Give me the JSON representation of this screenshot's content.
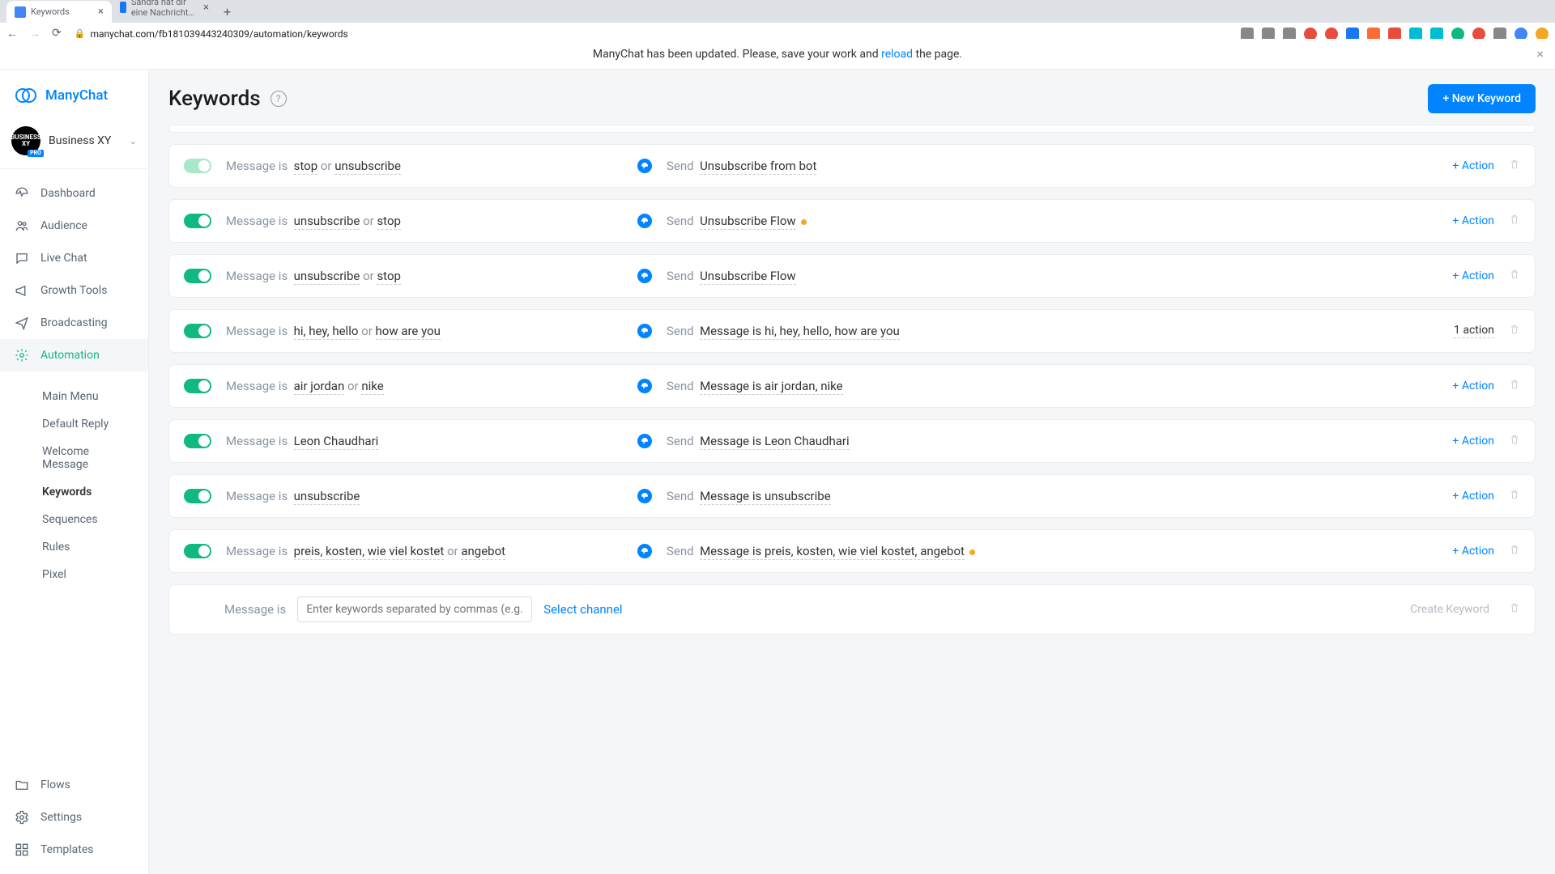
{
  "browser": {
    "tabs": [
      {
        "title": "Keywords",
        "active": true,
        "favicon": "blue"
      },
      {
        "title": "Sandra hat dir eine Nachricht…",
        "active": false,
        "favicon": "fb"
      }
    ],
    "url": "manychat.com/fb181039443240309/automation/keywords"
  },
  "banner": {
    "prefix": "ManyChat has been updated. Please, save your work and ",
    "link": "reload",
    "suffix": " the page."
  },
  "brand": {
    "name": "ManyChat"
  },
  "workspace": {
    "name": "Business XY",
    "badge": "PRO",
    "avatar_text": "BUSINESS XY"
  },
  "nav": {
    "dashboard": "Dashboard",
    "audience": "Audience",
    "livechat": "Live Chat",
    "growth": "Growth Tools",
    "broadcasting": "Broadcasting",
    "automation": "Automation",
    "flows": "Flows",
    "settings": "Settings",
    "templates": "Templates"
  },
  "subnav": {
    "main_menu": "Main Menu",
    "default_reply": "Default Reply",
    "welcome": "Welcome Message",
    "keywords": "Keywords",
    "sequences": "Sequences",
    "rules": "Rules",
    "pixel": "Pixel"
  },
  "page": {
    "title": "Keywords",
    "new_keyword_btn": "+ New Keyword",
    "help": "?"
  },
  "labels": {
    "message_is": "Message is",
    "or": "or",
    "send": "Send",
    "add_action": "+ Action"
  },
  "rules": [
    {
      "enabled": false,
      "keywords": [
        "stop",
        "unsubscribe"
      ],
      "flow": "Unsubscribe from bot",
      "warn": false,
      "action_type": "add"
    },
    {
      "enabled": true,
      "keywords": [
        "unsubscribe",
        "stop"
      ],
      "flow": "Unsubscribe Flow",
      "warn": true,
      "action_type": "add"
    },
    {
      "enabled": true,
      "keywords": [
        "unsubscribe",
        "stop"
      ],
      "flow": "Unsubscribe Flow",
      "warn": false,
      "action_type": "add"
    },
    {
      "enabled": true,
      "keywords": [
        "hi, hey, hello",
        "how are you"
      ],
      "flow": "Message is hi, hey, hello, how are you",
      "warn": false,
      "action_type": "count",
      "action_count": "1 action"
    },
    {
      "enabled": true,
      "keywords": [
        "air jordan",
        "nike"
      ],
      "flow": "Message is air jordan, nike",
      "warn": false,
      "action_type": "add"
    },
    {
      "enabled": true,
      "keywords": [
        "Leon Chaudhari"
      ],
      "flow": "Message is Leon Chaudhari",
      "warn": false,
      "action_type": "add"
    },
    {
      "enabled": true,
      "keywords": [
        "unsubscribe"
      ],
      "flow": "Message is unsubscribe",
      "warn": false,
      "action_type": "add"
    },
    {
      "enabled": true,
      "keywords": [
        "preis, kosten, wie viel kostet",
        "angebot"
      ],
      "flow": "Message is preis, kosten, wie viel kostet, angebot",
      "warn": true,
      "action_type": "add"
    }
  ],
  "new_row": {
    "placeholder": "Enter keywords separated by commas (e.g. \"hi, hey,",
    "select_channel": "Select channel",
    "create": "Create Keyword"
  }
}
